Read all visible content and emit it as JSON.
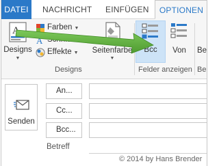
{
  "tabs": [
    {
      "label": "DATEI"
    },
    {
      "label": "NACHRICHT"
    },
    {
      "label": "EINFÜGEN"
    },
    {
      "label": "OPTIONEN"
    }
  ],
  "ribbon": {
    "designs_group": {
      "designs_label": "Designs",
      "farben_label": "Farben",
      "schriftarten_label": "Schriftarten",
      "effekte_label": "Effekte",
      "seitenfarbe_label": "Seitenfarbe",
      "group_label": "Designs"
    },
    "felder_group": {
      "bcc_label": "Bcc",
      "von_label": "Von",
      "group_label": "Felder anzeigen"
    },
    "cut_group": {
      "label": "Be",
      "group_label": "Be"
    }
  },
  "compose": {
    "send_label": "Senden",
    "an_label": "An...",
    "cc_label": "Cc...",
    "bcc_label": "Bcc...",
    "subject_label": "Betreff"
  },
  "watermark": "© 2014 by Hans Brender",
  "colors": {
    "accent": "#2b79c8",
    "highlight": "#cde3f7",
    "arrow": "#5cae3a"
  }
}
